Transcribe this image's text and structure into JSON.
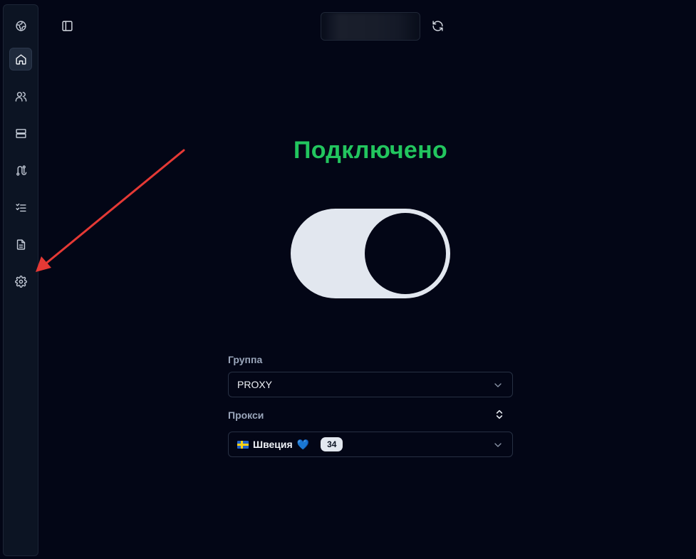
{
  "sidebar": {
    "items": [
      {
        "name": "logo-globe-icon"
      },
      {
        "name": "home-icon",
        "active": true
      },
      {
        "name": "users-icon"
      },
      {
        "name": "server-icon"
      },
      {
        "name": "route-icon"
      },
      {
        "name": "checklist-icon"
      },
      {
        "name": "document-icon"
      },
      {
        "name": "settings-gear-icon"
      }
    ]
  },
  "header": {
    "toggle_icon": "sidebar-toggle-icon",
    "refresh_icon": "refresh-icon"
  },
  "status": {
    "title": "Подключено",
    "color": "#22c55e",
    "connected": true
  },
  "form": {
    "group_label": "Группа",
    "group_value": "PROXY",
    "proxy_label": "Прокси",
    "proxy_name": "Швеция",
    "proxy_flag": "sweden-flag",
    "proxy_emoji": "💙",
    "proxy_badge": "34"
  },
  "annotation": {
    "type": "red-arrow",
    "color": "#e53935",
    "points_to": "settings-gear-icon"
  }
}
